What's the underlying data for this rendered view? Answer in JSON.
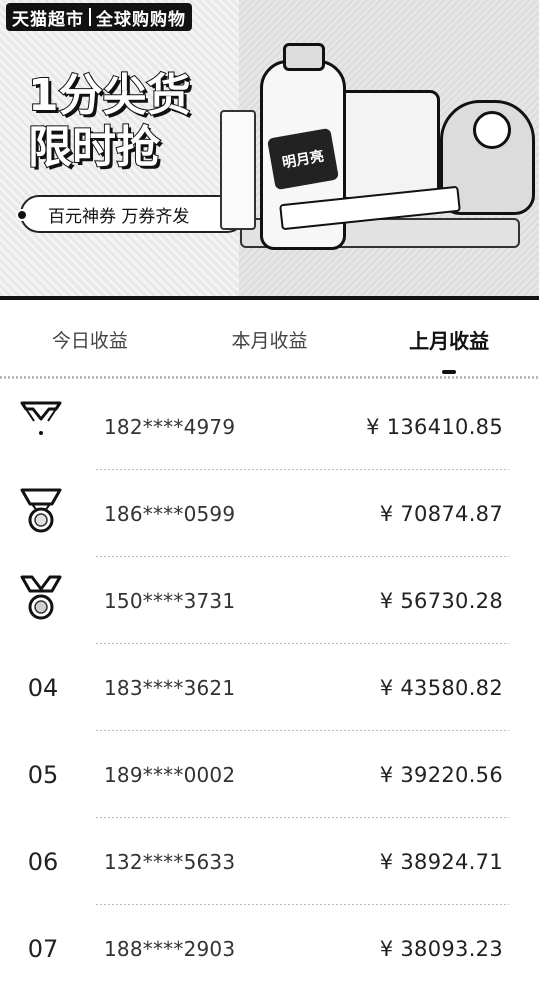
{
  "banner": {
    "brand_left": "天猫超市",
    "brand_right": "全球购购物",
    "headline_line1": "1分尖货",
    "headline_line2": "限时抢",
    "pill_text": "百元神券 万券齐发",
    "bottle_label": "明月亮"
  },
  "tabs": [
    {
      "label": "今日收益",
      "active": false
    },
    {
      "label": "本月收益",
      "active": false
    },
    {
      "label": "上月收益",
      "active": true
    }
  ],
  "ranking": [
    {
      "rank": "01",
      "medal": "gold-medal-icon",
      "phone": "182****4979",
      "amount": "¥ 136410.85"
    },
    {
      "rank": "02",
      "medal": "silver-medal-icon",
      "phone": "186****0599",
      "amount": "¥ 70874.87"
    },
    {
      "rank": "03",
      "medal": "bronze-medal-icon",
      "phone": "150****3731",
      "amount": "¥ 56730.28"
    },
    {
      "rank": "04",
      "medal": null,
      "phone": "183****3621",
      "amount": "¥ 43580.82"
    },
    {
      "rank": "05",
      "medal": null,
      "phone": "189****0002",
      "amount": "¥ 39220.56"
    },
    {
      "rank": "06",
      "medal": null,
      "phone": "132****5633",
      "amount": "¥ 38924.71"
    },
    {
      "rank": "07",
      "medal": null,
      "phone": "188****2903",
      "amount": "¥ 38093.23"
    }
  ]
}
